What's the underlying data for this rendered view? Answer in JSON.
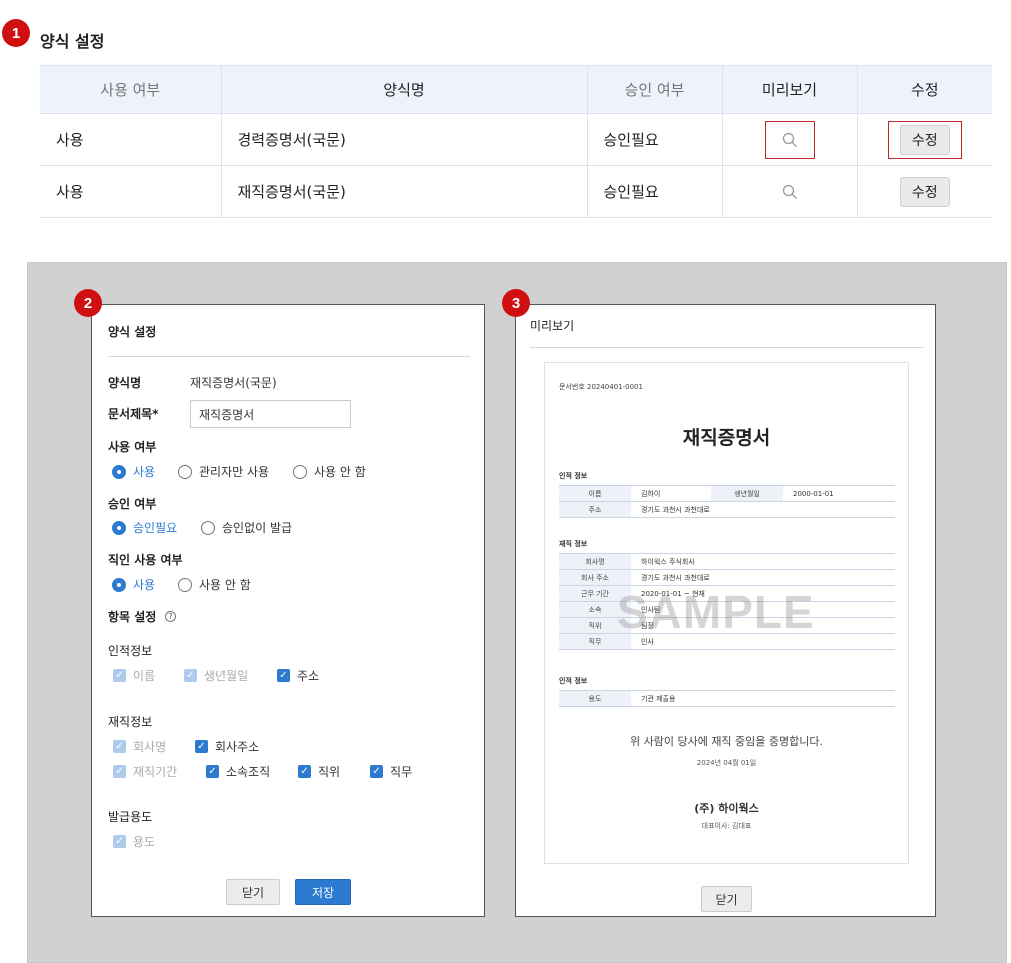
{
  "badges": [
    "1",
    "2",
    "3"
  ],
  "section_title": "양식 설정",
  "table": {
    "headers": [
      "사용 여부",
      "양식명",
      "승인 여부",
      "미리보기",
      "수정"
    ],
    "rows": [
      {
        "usage": "사용",
        "form_name": "경력증명서(국문)",
        "approval": "승인필요",
        "edit_label": "수정"
      },
      {
        "usage": "사용",
        "form_name": "재직증명서(국문)",
        "approval": "승인필요",
        "edit_label": "수정"
      }
    ]
  },
  "settings_dialog": {
    "title": "양식 설정",
    "form_name_label": "양식명",
    "form_name_value": "재직증명서(국문)",
    "doc_title_label": "문서제목*",
    "doc_title_value": "재직증명서",
    "usage_label": "사용 여부",
    "usage_options": [
      "사용",
      "관리자만 사용",
      "사용 안 함"
    ],
    "approval_label": "승인 여부",
    "approval_options": [
      "승인필요",
      "승인없이 발급"
    ],
    "seal_label": "직인 사용 여부",
    "seal_options": [
      "사용",
      "사용 안 함"
    ],
    "items_label": "항목 설정",
    "help_glyph": "?",
    "personal_label": "인적정보",
    "personal_items": [
      "이름",
      "생년월일",
      "주소"
    ],
    "employment_label": "재직정보",
    "employment_items": [
      "회사명",
      "회사주소",
      "재직기간",
      "소속조직",
      "직위",
      "직무"
    ],
    "purpose_label": "발급용도",
    "purpose_items": [
      "용도"
    ],
    "close_label": "닫기",
    "save_label": "저장"
  },
  "preview_dialog": {
    "title": "미리보기",
    "doc": {
      "doc_number": "문서번호 20240401-0001",
      "heading": "재직증명서",
      "personal_section": "인적 정보",
      "name_key": "이름",
      "name_value": "김하이",
      "birth_key": "생년월일",
      "birth_value": "2000-01-01",
      "address_key": "주소",
      "address_value": "경기도 과천시 과천대로",
      "employment_section": "재직 정보",
      "employment_rows": [
        {
          "k": "회사명",
          "v": "하이웍스 주식회사"
        },
        {
          "k": "회사 주소",
          "v": "경기도 과천시 과천대로"
        },
        {
          "k": "근무 기간",
          "v": "2020-01-01 ~ 현재"
        },
        {
          "k": "소속",
          "v": "인사팀"
        },
        {
          "k": "직위",
          "v": "팀장"
        },
        {
          "k": "직무",
          "v": "인사"
        }
      ],
      "purpose_section": "인적 정보",
      "purpose_key": "용도",
      "purpose_value": "기관 제출용",
      "watermark": "SAMPLE",
      "certify_text": "위 사람이 당사에 재직 중임을 증명합니다.",
      "issue_date": "2024년 04월 01일",
      "company": "(주) 하이웍스",
      "ceo": "대표이사: 김대표"
    },
    "close_label": "닫기"
  },
  "colors": {
    "badge": "#d01010",
    "accent": "#2d7bd1",
    "highlight_border": "#c0282a",
    "header_bg": "#eef3fb",
    "panel_bg": "#d1d1d1"
  },
  "icons": [
    "search-icon",
    "help-icon",
    "check-icon",
    "radio-icon"
  ]
}
